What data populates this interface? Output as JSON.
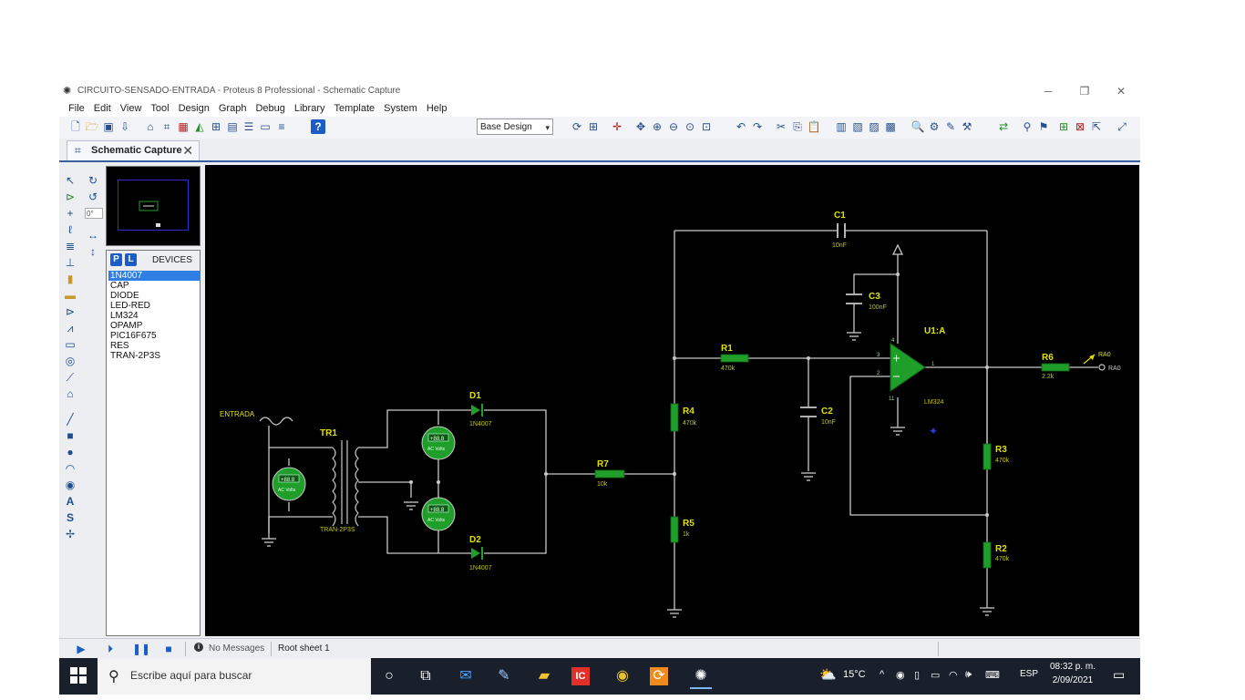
{
  "window": {
    "title": "CIRCUITO-SENSADO-ENTRADA - Proteus 8 Professional - Schematic Capture",
    "controls": {
      "minimize": "─",
      "maximize": "❐",
      "close": "✕"
    }
  },
  "menu": [
    "File",
    "Edit",
    "View",
    "Tool",
    "Design",
    "Graph",
    "Debug",
    "Library",
    "Template",
    "System",
    "Help"
  ],
  "toolbar": {
    "design_select_value": "Base Design"
  },
  "tab": {
    "label": "Schematic Capture",
    "close": "✕"
  },
  "left_panel": {
    "rotation_value": "0°",
    "pick_button": "P",
    "library_button": "L",
    "devices_title": "DEVICES",
    "devices": [
      "1N4007",
      "CAP",
      "DIODE",
      "LED-RED",
      "LM324",
      "OPAMP",
      "PIC16F675",
      "RES",
      "TRAN-2P3S"
    ],
    "selected_device_index": 0
  },
  "status": {
    "messages": "No Messages",
    "sheet": "Root sheet 1"
  },
  "schematic": {
    "input_label": "ENTRADA",
    "transformer": {
      "ref": "TR1",
      "part": "TRAN-2P3S"
    },
    "voltmeter_labels": [
      "+88.8",
      "AC Volts"
    ],
    "diodes": [
      {
        "ref": "D1",
        "part": "1N4007"
      },
      {
        "ref": "D2",
        "part": "1N4007"
      }
    ],
    "resistors": [
      {
        "ref": "R1",
        "value": "470k"
      },
      {
        "ref": "R4",
        "value": "470k"
      },
      {
        "ref": "R5",
        "value": "1k"
      },
      {
        "ref": "R7",
        "value": "10k"
      },
      {
        "ref": "R6",
        "value": "2.2k"
      },
      {
        "ref": "R3",
        "value": "470k"
      },
      {
        "ref": "R2",
        "value": "470k"
      }
    ],
    "capacitors": [
      {
        "ref": "C1",
        "value": "10nF"
      },
      {
        "ref": "C3",
        "value": "100nF"
      },
      {
        "ref": "C2",
        "value": "10nF"
      }
    ],
    "opamp": {
      "ref": "U1:A",
      "part": "LM324",
      "pins": [
        "3",
        "2",
        "1",
        "4",
        "11"
      ]
    },
    "output_terminal": "RA0",
    "output_probe": "RA0"
  },
  "taskbar": {
    "search_placeholder": "Escribe aquí para buscar",
    "weather": "15°C",
    "language": "ESP",
    "time": "08:32 p. m.",
    "date": "2/09/2021"
  },
  "colors": {
    "wire": "#c8c8c8",
    "component": "#1f9e2a",
    "label": "#e0e000",
    "canvas": "#000000"
  }
}
